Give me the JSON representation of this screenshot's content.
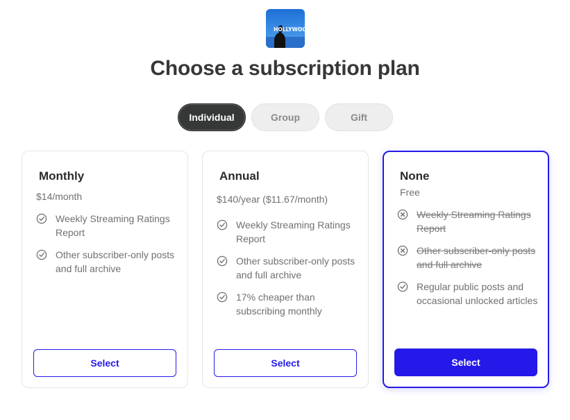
{
  "logo": {
    "text": "HOLLYWOOD"
  },
  "page_title": "Choose a subscription plan",
  "tabs": [
    {
      "label": "Individual",
      "active": true
    },
    {
      "label": "Group",
      "active": false
    },
    {
      "label": "Gift",
      "active": false
    }
  ],
  "plans": [
    {
      "name": "Monthly",
      "price": "$14/month",
      "features": [
        {
          "text": "Weekly Streaming Ratings Report",
          "icon": "check-circle-icon",
          "included": true
        },
        {
          "text": "Other subscriber-only posts and full archive",
          "icon": "check-circle-icon",
          "included": true
        }
      ],
      "button": "Select",
      "selected": false
    },
    {
      "name": "Annual",
      "price": "$140/year ($11.67/month)",
      "features": [
        {
          "text": "Weekly Streaming Ratings Report",
          "icon": "check-circle-icon",
          "included": true
        },
        {
          "text": "Other subscriber-only posts and full archive",
          "icon": "check-circle-icon",
          "included": true
        },
        {
          "text": "17% cheaper than subscribing monthly",
          "icon": "check-circle-icon",
          "included": true
        }
      ],
      "button": "Select",
      "selected": false
    },
    {
      "name": "None",
      "price": "Free",
      "features": [
        {
          "text": "Weekly Streaming Ratings Report",
          "icon": "x-circle-icon",
          "included": false
        },
        {
          "text": "Other subscriber-only posts and full archive",
          "icon": "x-circle-icon",
          "included": false
        },
        {
          "text": "Regular public posts and occasional unlocked articles",
          "icon": "check-circle-icon",
          "included": true
        }
      ],
      "button": "Select",
      "selected": true
    }
  ],
  "colors": {
    "accent": "#2519ea",
    "title": "#363737",
    "muted_text": "#707070"
  }
}
